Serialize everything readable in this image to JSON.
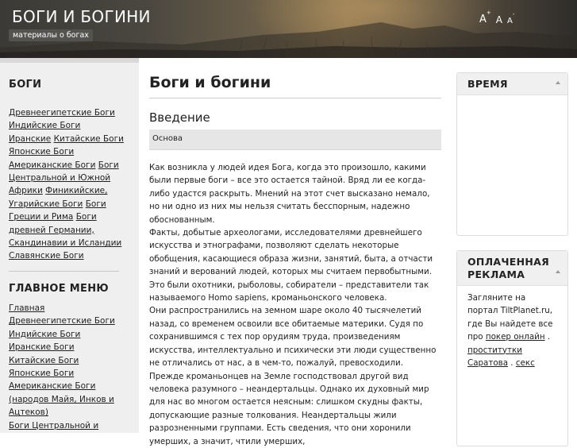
{
  "header": {
    "site_title": "БОГИ И БОГИНИ",
    "site_subtitle": "материалы о богах",
    "font_controls": {
      "larger": "A",
      "normal": "A",
      "smaller": "A",
      "plus": "+",
      "minus": "-"
    }
  },
  "sidebar": {
    "gods_title": "БОГИ",
    "gods_links": [
      "Древнеегипетские Боги",
      "Индийские Боги",
      "Иранские",
      "Китайские Боги",
      "Японские Боги",
      "Американские Боги",
      "Боги Центральной и Южной Африки",
      "Финикийские, Угарийские Боги",
      "Боги Греции и Рима",
      "Боги древней Германии, Скандинавии и Исландии",
      "Славянские Боги"
    ],
    "menu_title": "ГЛАВНОЕ МЕНЮ",
    "menu_links": [
      "Главная",
      "Древнеегипетские Боги",
      "Индийские Боги",
      "Иранские Боги",
      "Китайские Боги",
      "Японские Боги",
      "Американские Боги (народов Майя, Инков и Ацтеков)",
      "Боги Центральной и"
    ]
  },
  "main": {
    "page_title": "Боги и богини",
    "section_title": "Введение",
    "tab_label": "Основа",
    "paragraphs": [
      " Как возникла у людей идея Бога, когда это произошло, какими были первые боги – все это остается тайной. Вряд ли ее когда-либо удастся раскрыть. Мнений на этот счет высказано немало, но ни одно из них мы нельзя считать бесспорным, надежно обоснованным.",
      " Факты, добытые археологами, исследователями древнейшего искусства и этнографами, позволяют сделать некоторые обобщения, касающиеся образа жизни, занятий, быта, а отчасти знаний и верований людей, которых мы считаем первобытными. Это были охотники, рыболовы, собиратели – представители так называемого Homo sapiens, кроманьонского человека.",
      "Они распространились на земном шаре около 40 тысячелетий назад, со временем освоили все обитаемые материки. Судя по сохранившимся с тех пор орудиям труда, произведениям искусства, интеллектуально и психически эти люди существенно не отличались от нас, а в чем-то, пожалуй, превосходили.",
      " Прежде кроманьонцев на Земле господствовал другой вид человека разумного – неандертальцы. Однако их духовный мир для нас во многом остается неясным: слишком скудны факты, допускающие разные толкования. Неандертальцы жили разрозненными группами. Есть сведения, что они хоронили умерших, а значит, чтили умерших,"
    ]
  },
  "right": {
    "time_title": "ВРЕМЯ",
    "ads_title": "ОПЛАЧЕННАЯ РЕКЛАМА",
    "ads_text_1": "Загляните на портал TiltPlanet.ru, где Вы найдете все про ",
    "ads_link_1": "покер онлайн",
    "ads_text_2": " . ",
    "ads_link_2": "проститутки Саратова",
    "ads_text_3": " . ",
    "ads_link_3": "секс"
  }
}
